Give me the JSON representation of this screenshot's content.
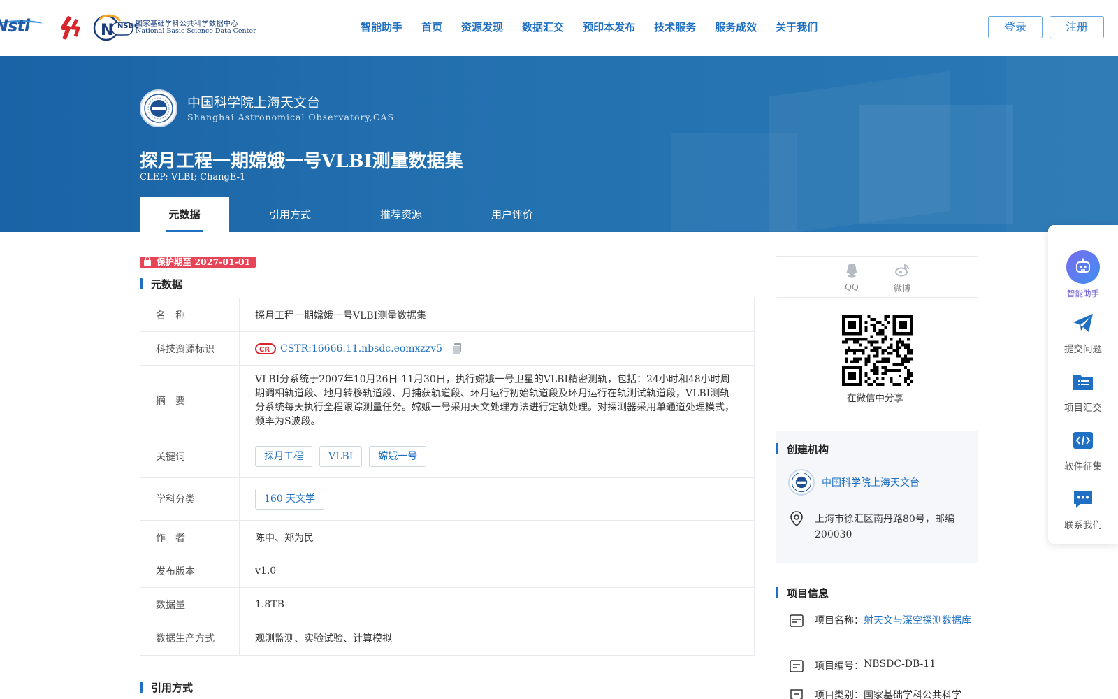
{
  "header": {
    "logo_nsti": "Nsti",
    "logo_nsdc_mark": "NSDC",
    "logo_nsdc_cn": "国家基础学科公共科学数据中心",
    "logo_nsdc_en": "National Basic Science Data Center",
    "nav": [
      "智能助手",
      "首页",
      "资源发现",
      "数据汇交",
      "预印本发布",
      "技术服务",
      "服务成效",
      "关于我们"
    ],
    "login_label": "登录",
    "register_label": "注册"
  },
  "banner": {
    "org_cn": "中国科学院上海天文台",
    "org_en": "Shanghai Astronomical Observatory,CAS",
    "title": "探月工程一期嫦娥一号VLBI测量数据集",
    "subtitle": "CLEP; VLBI; ChangE-1",
    "tabs": [
      "元数据",
      "引用方式",
      "推荐资源",
      "用户评价"
    ],
    "active_tab": "元数据"
  },
  "main": {
    "protect_badge": "保护期至 2027-01-01",
    "section_metadata": "元数据",
    "section_citation": "引用方式",
    "rows": {
      "name_key": "名　称",
      "name_val": "探月工程一期嫦娥一号VLBI测量数据集",
      "id_key": "科技资源标识",
      "id_val": "CSTR:16666.11.nbsdc.eomxzzv5",
      "abstract_key": "摘　要",
      "abstract_val": "VLBI分系统于2007年10月26日-11月30日，执行嫦娥一号卫星的VLBI精密测轨，包括：24小时和48小时周期调相轨道段、地月转移轨道段、月捕获轨道段、环月运行初始轨道段及环月运行在轨测试轨道段，VLBI测轨分系统每天执行全程跟踪测量任务。嫦娥一号采用天文处理方法进行定轨处理。对探测器采用单通道处理模式，频率为S波段。",
      "keywords_key": "关键词",
      "keywords": [
        "探月工程",
        "VLBI",
        "嫦娥一号"
      ],
      "subject_key": "学科分类",
      "subject": "160 天文学",
      "author_key": "作　者",
      "author_val": "陈中、郑为民",
      "version_key": "发布版本",
      "version_val": "v1.0",
      "volume_key": "数据量",
      "volume_val": "1.8TB",
      "method_key": "数据生产方式",
      "method_val": "观测监测、实验试验、计算模拟"
    }
  },
  "aside": {
    "share_qq": "QQ",
    "share_weibo": "微博",
    "qr_label": "在微信中分享",
    "org_section": "创建机构",
    "org_name": "中国科学院上海天文台",
    "org_address": "上海市徐汇区南丹路80号，邮编200030",
    "proj_section": "项目信息",
    "proj_name_label": "项目名称：",
    "proj_name": "射天文与深空探测数据库",
    "proj_code_label": "项目编号：",
    "proj_code": "NBSDC-DB-11",
    "proj_type_label": "项目类别：",
    "proj_type": "国家基础学科公共科学"
  },
  "float_bar": {
    "ai": "智能助手",
    "submit": "提交问题",
    "project": "项目汇交",
    "software": "软件征集",
    "contact": "联系我们"
  },
  "colors": {
    "brand_blue": "#1f6fc3",
    "banner_blue": "#1a63a6",
    "protect_red": "#e64557"
  }
}
